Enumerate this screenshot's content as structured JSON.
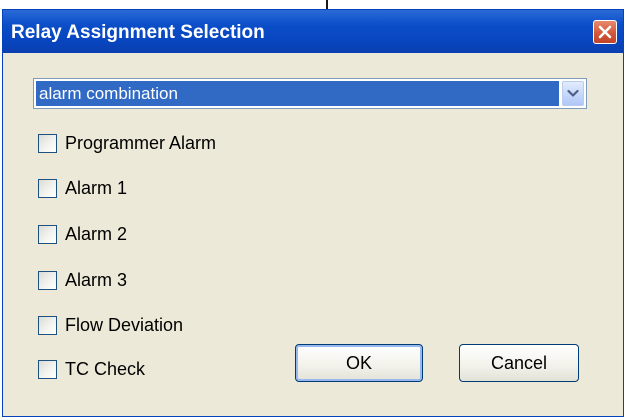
{
  "window": {
    "title": "Relay Assignment Selection",
    "close_icon": "close-icon"
  },
  "combo": {
    "selected_value": "alarm combination",
    "dropdown_icon": "chevron-down-icon"
  },
  "checkboxes": [
    {
      "label": "Programmer Alarm",
      "checked": false
    },
    {
      "label": "Alarm 1",
      "checked": false
    },
    {
      "label": "Alarm 2",
      "checked": false
    },
    {
      "label": "Alarm 3",
      "checked": false
    },
    {
      "label": "Flow Deviation",
      "checked": false
    },
    {
      "label": "TC Check",
      "checked": false
    }
  ],
  "buttons": {
    "ok_label": "OK",
    "cancel_label": "Cancel"
  },
  "colors": {
    "titlebar": "#0846c0",
    "selection": "#316ac5",
    "dialog_bg": "#ece9d8",
    "close_button": "#d4573a"
  }
}
